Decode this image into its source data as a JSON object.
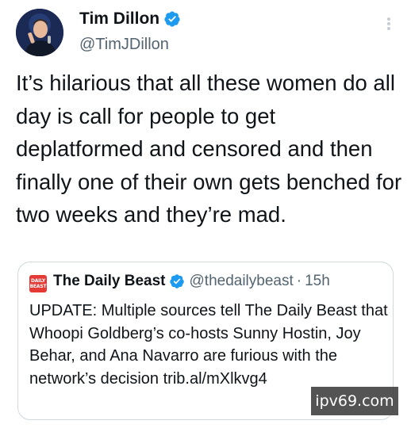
{
  "tweet": {
    "display_name": "Tim Dillon",
    "handle": "@TimJDillon",
    "verified": true,
    "text": "It’s hilarious that all these women do all day is call for people to get deplatformed and censored and then finally one of their own gets benched for two weeks and they’re mad."
  },
  "quote": {
    "display_name": "The Daily Beast",
    "verified": true,
    "handle": "@thedailybeast",
    "separator": "·",
    "time": "15h",
    "logo_text_top": "DAILY",
    "logo_text_bottom": "BEAST",
    "text": "UPDATE: Multiple sources tell The Daily Beast that Whoopi Goldberg’s co-hosts Sunny Hostin, Joy Behar, and Ana Navarro are furious with the network’s decision trib.al/mXlkvg4"
  },
  "watermark": {
    "text": "ipv69.com"
  },
  "icons": {
    "verified": "verified-badge-icon",
    "more": "more-options-icon"
  },
  "colors": {
    "verified_blue": "#1d9bf0",
    "text": "#0f1419",
    "secondary_text": "#536471",
    "border": "#cfd9de",
    "logo_red": "#e53935"
  }
}
